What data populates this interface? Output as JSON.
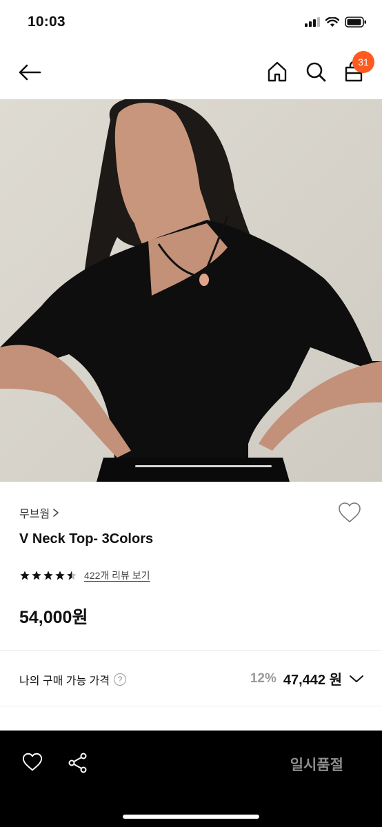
{
  "status": {
    "time": "10:03",
    "icons": [
      "signal-icon",
      "wifi-icon",
      "battery-icon"
    ]
  },
  "nav": {
    "icons": [
      "back-arrow-icon",
      "home-icon",
      "search-icon",
      "cart-icon"
    ],
    "cart_count": "31",
    "badge_color": "#ff5a1f"
  },
  "product": {
    "brand": "무브웜",
    "title": "V Neck Top- 3Colors",
    "rating": 4.5,
    "review_link": "422개 리뷰 보기",
    "price": "54,000원"
  },
  "my_price": {
    "label": "나의 구매 가능 가격",
    "help": "?",
    "discount": "12%",
    "value": "47,442 원"
  },
  "bottom_bar": {
    "sold_out_label": "일시품절",
    "icons": [
      "heart-icon",
      "share-icon"
    ]
  }
}
